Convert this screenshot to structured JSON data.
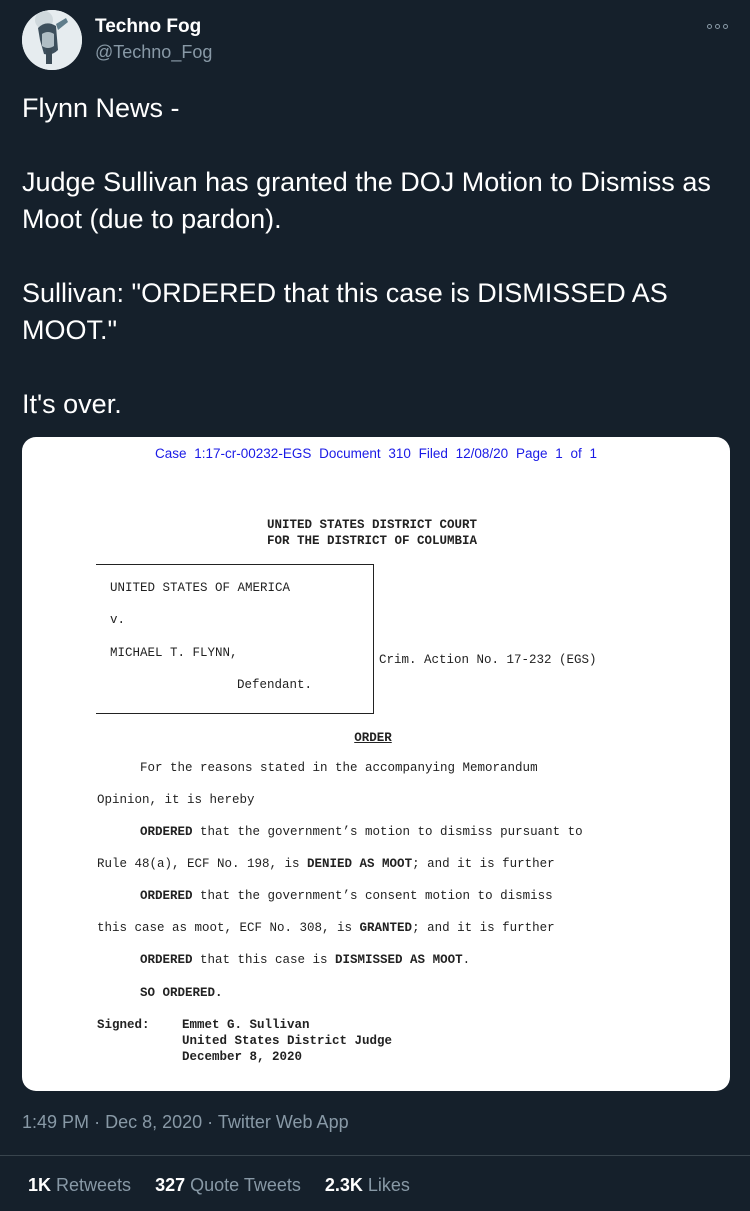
{
  "author": {
    "name": "Techno Fog",
    "handle": "@Techno_Fog"
  },
  "tweet": {
    "lines": [
      "Flynn News -",
      "",
      "Judge Sullivan has granted the DOJ Motion to Dismiss as Moot (due to pardon).",
      "",
      "Sullivan: \"ORDERED that this case is DISMISSED AS MOOT.\"",
      "",
      "It's over."
    ]
  },
  "document": {
    "header": "Case 1:17-cr-00232-EGS   Document 310   Filed 12/08/20   Page 1 of 1",
    "court_line1": "UNITED STATES DISTRICT COURT",
    "court_line2": "FOR THE DISTRICT OF COLUMBIA",
    "plaintiff": "UNITED STATES OF AMERICA",
    "versus": "v.",
    "defendant_name": "MICHAEL T. FLYNN,",
    "defendant_label": "Defendant.",
    "crim_action": "Crim. Action No. 17-232 (EGS)",
    "order_title": "ORDER",
    "p1_line1": "For the reasons stated in the accompanying Memorandum",
    "p1_line2": "Opinion, it is hereby",
    "ordered_word": "ORDERED",
    "p2_line1_rest": " that the government’s motion to dismiss pursuant to",
    "p2_line2_pre": "Rule 48(a), ECF No. 198, is ",
    "p2_bold": "DENIED AS MOOT",
    "p2_line2_post": "; and it is further",
    "p3_line1_rest": " that the government’s consent motion to dismiss",
    "p3_line2_pre": "this case as moot, ECF No. 308, is ",
    "p3_bold": "GRANTED",
    "p3_line2_post": "; and it is further",
    "p4_rest": " that this case is ",
    "p4_bold": "DISMISSED AS MOOT",
    "p4_end": ".",
    "so_ordered": "SO ORDERED.",
    "signed_label": "Signed:",
    "signer_name": "Emmet G. Sullivan",
    "signer_title": "United States District Judge",
    "signed_date": "December 8, 2020"
  },
  "meta": {
    "time": "1:49 PM",
    "separator": "·",
    "date": "Dec 8, 2020",
    "app": "Twitter Web App"
  },
  "stats": {
    "retweets_count": "1K",
    "retweets_label": "Retweets",
    "quotes_count": "327",
    "quotes_label": "Quote Tweets",
    "likes_count": "2.3K",
    "likes_label": "Likes"
  },
  "colors": {
    "background": "#15202b",
    "secondary_text": "#8899a6",
    "divider": "#38444d",
    "doc_header_blue": "#1a1ae6"
  }
}
